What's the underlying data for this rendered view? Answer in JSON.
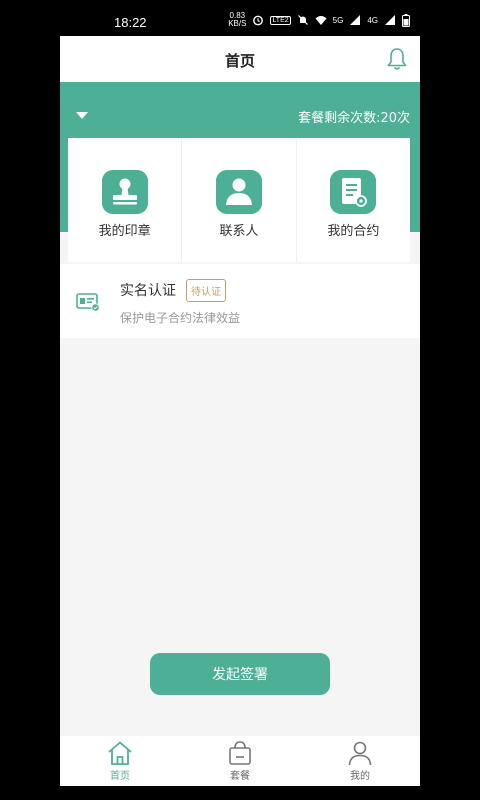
{
  "status_bar": {
    "time": "18:22",
    "speed_value": "0.83",
    "speed_unit": "KB/S",
    "volte": "LTE2",
    "net_5g": "5G",
    "net_4g": "4G"
  },
  "header": {
    "title": "首页",
    "bell_icon": "bell-icon"
  },
  "banner": {
    "remaining_text": "套餐剩余次数:20次",
    "accent_color": "#4db096"
  },
  "quick_actions": [
    {
      "label": "我的印章",
      "icon": "stamp-icon"
    },
    {
      "label": "联系人",
      "icon": "person-icon"
    },
    {
      "label": "我的合约",
      "icon": "contract-icon"
    }
  ],
  "verification": {
    "title": "实名认证",
    "badge": "待认证",
    "description": "保护电子合约法律效益",
    "icon": "id-card-icon",
    "badge_color": "#c9a064"
  },
  "primary_action": {
    "label": "发起签署"
  },
  "tabbar": [
    {
      "label": "首页",
      "icon": "home-icon",
      "active": true
    },
    {
      "label": "套餐",
      "icon": "bag-icon",
      "active": false
    },
    {
      "label": "我的",
      "icon": "user-icon",
      "active": false
    }
  ]
}
